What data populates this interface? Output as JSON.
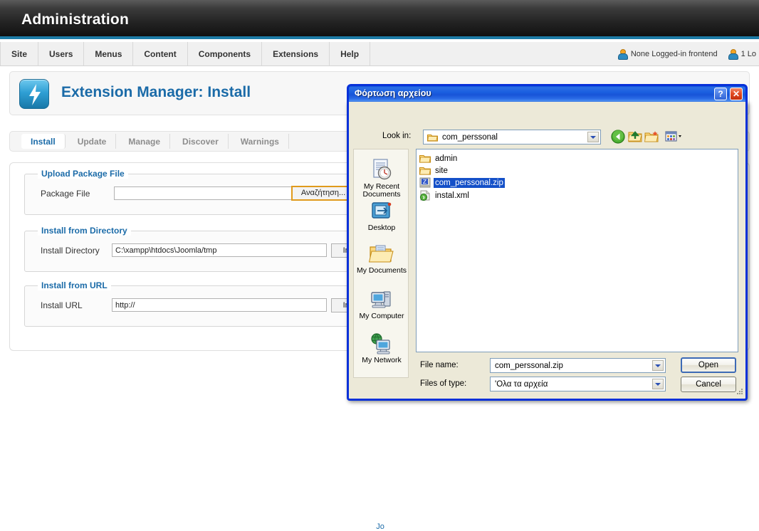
{
  "joomla": {
    "header_title": "Administration",
    "menu": [
      "Site",
      "Users",
      "Menus",
      "Content",
      "Components",
      "Extensions",
      "Help"
    ],
    "status": {
      "frontend": "None Logged-in frontend",
      "backend": "1 Lo"
    },
    "page_title": "Extension Manager: Install",
    "page_icon": "lightning-bolt-icon",
    "tabs": [
      {
        "label": "Install",
        "active": true
      },
      {
        "label": "Update",
        "active": false
      },
      {
        "label": "Manage",
        "active": false
      },
      {
        "label": "Discover",
        "active": false
      },
      {
        "label": "Warnings",
        "active": false
      }
    ],
    "fieldsets": [
      {
        "legend": "Upload Package File",
        "field_label": "Package File",
        "field_value": "",
        "button_label": "Αναζήτηση...",
        "button_style": "browse"
      },
      {
        "legend": "Install from Directory",
        "field_label": "Install Directory",
        "field_value": "C:\\xampp\\htdocs\\Joomla/tmp",
        "button_label": "Install",
        "button_style": "plain"
      },
      {
        "legend": "Install from URL",
        "field_label": "Install URL",
        "field_value": "http://",
        "button_label": "Install",
        "button_style": "plain"
      }
    ],
    "footer": "Jo"
  },
  "dialog": {
    "title": "Φόρτωση αρχείου",
    "help_btn": "?",
    "close_btn": "✕",
    "lookin_label": "Look in:",
    "lookin_value": "com_perssonal",
    "toolbar": [
      {
        "name": "back-icon",
        "tip": "Back"
      },
      {
        "name": "up-one-level-icon",
        "tip": "Up One Level"
      },
      {
        "name": "new-folder-icon",
        "tip": "Create New Folder"
      },
      {
        "name": "views-icon",
        "tip": "Views"
      }
    ],
    "places": [
      {
        "label": "My Recent Documents",
        "icon": "recent-documents-icon"
      },
      {
        "label": "Desktop",
        "icon": "desktop-icon"
      },
      {
        "label": "My Documents",
        "icon": "my-documents-icon"
      },
      {
        "label": "My Computer",
        "icon": "my-computer-icon"
      },
      {
        "label": "My Network",
        "icon": "my-network-icon"
      }
    ],
    "files": [
      {
        "name": "admin",
        "type": "folder",
        "selected": false
      },
      {
        "name": "site",
        "type": "folder",
        "selected": false
      },
      {
        "name": "com_perssonal.zip",
        "type": "zip",
        "selected": true
      },
      {
        "name": "instal.xml",
        "type": "xml",
        "selected": false
      }
    ],
    "filename_label": "File name:",
    "filename_value": "com_perssonal.zip",
    "filetype_label": "Files of type:",
    "filetype_value": "'Ολα τα αρχεία",
    "open_button": "Open",
    "cancel_button": "Cancel"
  },
  "colors": {
    "joomla_blue": "#1b6ba8",
    "header_accent": "#1d7ba6",
    "xp_titlebar": "#0831d9",
    "selection": "#1450c8",
    "browse_border": "#e09a1c"
  }
}
